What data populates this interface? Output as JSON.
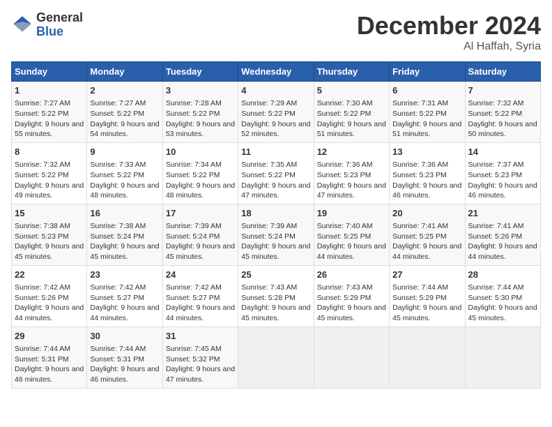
{
  "header": {
    "logo_general": "General",
    "logo_blue": "Blue",
    "month": "December 2024",
    "location": "Al Haffah, Syria"
  },
  "days_of_week": [
    "Sunday",
    "Monday",
    "Tuesday",
    "Wednesday",
    "Thursday",
    "Friday",
    "Saturday"
  ],
  "weeks": [
    [
      {
        "day": 1,
        "sunrise": "7:27 AM",
        "sunset": "5:22 PM",
        "daylight": "9 hours and 55 minutes."
      },
      {
        "day": 2,
        "sunrise": "7:27 AM",
        "sunset": "5:22 PM",
        "daylight": "9 hours and 54 minutes."
      },
      {
        "day": 3,
        "sunrise": "7:28 AM",
        "sunset": "5:22 PM",
        "daylight": "9 hours and 53 minutes."
      },
      {
        "day": 4,
        "sunrise": "7:29 AM",
        "sunset": "5:22 PM",
        "daylight": "9 hours and 52 minutes."
      },
      {
        "day": 5,
        "sunrise": "7:30 AM",
        "sunset": "5:22 PM",
        "daylight": "9 hours and 51 minutes."
      },
      {
        "day": 6,
        "sunrise": "7:31 AM",
        "sunset": "5:22 PM",
        "daylight": "9 hours and 51 minutes."
      },
      {
        "day": 7,
        "sunrise": "7:32 AM",
        "sunset": "5:22 PM",
        "daylight": "9 hours and 50 minutes."
      }
    ],
    [
      {
        "day": 8,
        "sunrise": "7:32 AM",
        "sunset": "5:22 PM",
        "daylight": "9 hours and 49 minutes."
      },
      {
        "day": 9,
        "sunrise": "7:33 AM",
        "sunset": "5:22 PM",
        "daylight": "9 hours and 48 minutes."
      },
      {
        "day": 10,
        "sunrise": "7:34 AM",
        "sunset": "5:22 PM",
        "daylight": "9 hours and 48 minutes."
      },
      {
        "day": 11,
        "sunrise": "7:35 AM",
        "sunset": "5:22 PM",
        "daylight": "9 hours and 47 minutes."
      },
      {
        "day": 12,
        "sunrise": "7:36 AM",
        "sunset": "5:23 PM",
        "daylight": "9 hours and 47 minutes."
      },
      {
        "day": 13,
        "sunrise": "7:36 AM",
        "sunset": "5:23 PM",
        "daylight": "9 hours and 46 minutes."
      },
      {
        "day": 14,
        "sunrise": "7:37 AM",
        "sunset": "5:23 PM",
        "daylight": "9 hours and 46 minutes."
      }
    ],
    [
      {
        "day": 15,
        "sunrise": "7:38 AM",
        "sunset": "5:23 PM",
        "daylight": "9 hours and 45 minutes."
      },
      {
        "day": 16,
        "sunrise": "7:38 AM",
        "sunset": "5:24 PM",
        "daylight": "9 hours and 45 minutes."
      },
      {
        "day": 17,
        "sunrise": "7:39 AM",
        "sunset": "5:24 PM",
        "daylight": "9 hours and 45 minutes."
      },
      {
        "day": 18,
        "sunrise": "7:39 AM",
        "sunset": "5:24 PM",
        "daylight": "9 hours and 45 minutes."
      },
      {
        "day": 19,
        "sunrise": "7:40 AM",
        "sunset": "5:25 PM",
        "daylight": "9 hours and 44 minutes."
      },
      {
        "day": 20,
        "sunrise": "7:41 AM",
        "sunset": "5:25 PM",
        "daylight": "9 hours and 44 minutes."
      },
      {
        "day": 21,
        "sunrise": "7:41 AM",
        "sunset": "5:26 PM",
        "daylight": "9 hours and 44 minutes."
      }
    ],
    [
      {
        "day": 22,
        "sunrise": "7:42 AM",
        "sunset": "5:26 PM",
        "daylight": "9 hours and 44 minutes."
      },
      {
        "day": 23,
        "sunrise": "7:42 AM",
        "sunset": "5:27 PM",
        "daylight": "9 hours and 44 minutes."
      },
      {
        "day": 24,
        "sunrise": "7:42 AM",
        "sunset": "5:27 PM",
        "daylight": "9 hours and 44 minutes."
      },
      {
        "day": 25,
        "sunrise": "7:43 AM",
        "sunset": "5:28 PM",
        "daylight": "9 hours and 45 minutes."
      },
      {
        "day": 26,
        "sunrise": "7:43 AM",
        "sunset": "5:29 PM",
        "daylight": "9 hours and 45 minutes."
      },
      {
        "day": 27,
        "sunrise": "7:44 AM",
        "sunset": "5:29 PM",
        "daylight": "9 hours and 45 minutes."
      },
      {
        "day": 28,
        "sunrise": "7:44 AM",
        "sunset": "5:30 PM",
        "daylight": "9 hours and 45 minutes."
      }
    ],
    [
      {
        "day": 29,
        "sunrise": "7:44 AM",
        "sunset": "5:31 PM",
        "daylight": "9 hours and 46 minutes."
      },
      {
        "day": 30,
        "sunrise": "7:44 AM",
        "sunset": "5:31 PM",
        "daylight": "9 hours and 46 minutes."
      },
      {
        "day": 31,
        "sunrise": "7:45 AM",
        "sunset": "5:32 PM",
        "daylight": "9 hours and 47 minutes."
      },
      null,
      null,
      null,
      null
    ]
  ]
}
